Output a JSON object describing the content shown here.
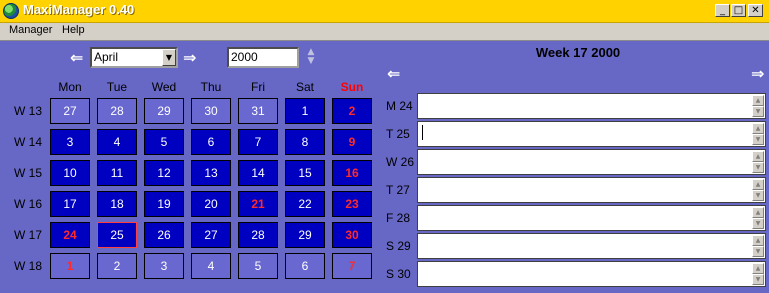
{
  "app": {
    "title": "MaxiManager 0.40"
  },
  "window_controls": {
    "minimize": "_",
    "maximize": "□",
    "close": "✕"
  },
  "menu": [
    "Manager",
    "Help"
  ],
  "nav": {
    "month": "April",
    "year": "2000",
    "prev_icon": "left-arrow-icon",
    "next_icon": "right-arrow-icon"
  },
  "calendar": {
    "day_headers": [
      "Mon",
      "Tue",
      "Wed",
      "Thu",
      "Fri",
      "Sat",
      "Sun"
    ],
    "weeks": [
      {
        "label": "W 13",
        "days": [
          {
            "d": "27",
            "type": "other"
          },
          {
            "d": "28",
            "type": "other"
          },
          {
            "d": "29",
            "type": "other"
          },
          {
            "d": "30",
            "type": "other"
          },
          {
            "d": "31",
            "type": "other"
          },
          {
            "d": "1",
            "type": "normal"
          },
          {
            "d": "2",
            "type": "holiday"
          }
        ]
      },
      {
        "label": "W 14",
        "days": [
          {
            "d": "3",
            "type": "normal"
          },
          {
            "d": "4",
            "type": "normal"
          },
          {
            "d": "5",
            "type": "normal"
          },
          {
            "d": "6",
            "type": "normal"
          },
          {
            "d": "7",
            "type": "normal"
          },
          {
            "d": "8",
            "type": "normal"
          },
          {
            "d": "9",
            "type": "holiday"
          }
        ]
      },
      {
        "label": "W 15",
        "days": [
          {
            "d": "10",
            "type": "normal"
          },
          {
            "d": "11",
            "type": "normal"
          },
          {
            "d": "12",
            "type": "normal"
          },
          {
            "d": "13",
            "type": "normal"
          },
          {
            "d": "14",
            "type": "normal"
          },
          {
            "d": "15",
            "type": "normal"
          },
          {
            "d": "16",
            "type": "holiday"
          }
        ]
      },
      {
        "label": "W 16",
        "days": [
          {
            "d": "17",
            "type": "normal"
          },
          {
            "d": "18",
            "type": "normal"
          },
          {
            "d": "19",
            "type": "normal"
          },
          {
            "d": "20",
            "type": "normal"
          },
          {
            "d": "21",
            "type": "holiday"
          },
          {
            "d": "22",
            "type": "normal"
          },
          {
            "d": "23",
            "type": "holiday"
          }
        ]
      },
      {
        "label": "W 17",
        "days": [
          {
            "d": "24",
            "type": "holiday"
          },
          {
            "d": "25",
            "type": "today"
          },
          {
            "d": "26",
            "type": "normal"
          },
          {
            "d": "27",
            "type": "normal"
          },
          {
            "d": "28",
            "type": "normal"
          },
          {
            "d": "29",
            "type": "normal"
          },
          {
            "d": "30",
            "type": "holiday"
          }
        ]
      },
      {
        "label": "W 18",
        "days": [
          {
            "d": "1",
            "type": "other-holiday"
          },
          {
            "d": "2",
            "type": "other"
          },
          {
            "d": "3",
            "type": "other"
          },
          {
            "d": "4",
            "type": "other"
          },
          {
            "d": "5",
            "type": "other"
          },
          {
            "d": "6",
            "type": "other"
          },
          {
            "d": "7",
            "type": "other-holiday"
          }
        ]
      }
    ]
  },
  "week_view": {
    "title": "Week 17 2000",
    "days": [
      {
        "label": "M 24",
        "note": ""
      },
      {
        "label": "T 25",
        "note": ""
      },
      {
        "label": "W 26",
        "note": ""
      },
      {
        "label": "T 27",
        "note": ""
      },
      {
        "label": "F 28",
        "note": ""
      },
      {
        "label": "S 29",
        "note": ""
      },
      {
        "label": "S 30",
        "note": ""
      }
    ]
  },
  "colors": {
    "titlebar": "#ffd200",
    "background": "#6767c6",
    "cell": "#0000c0",
    "cell_other_month": "#6868d0",
    "holiday_text": "#ff2a2a"
  }
}
